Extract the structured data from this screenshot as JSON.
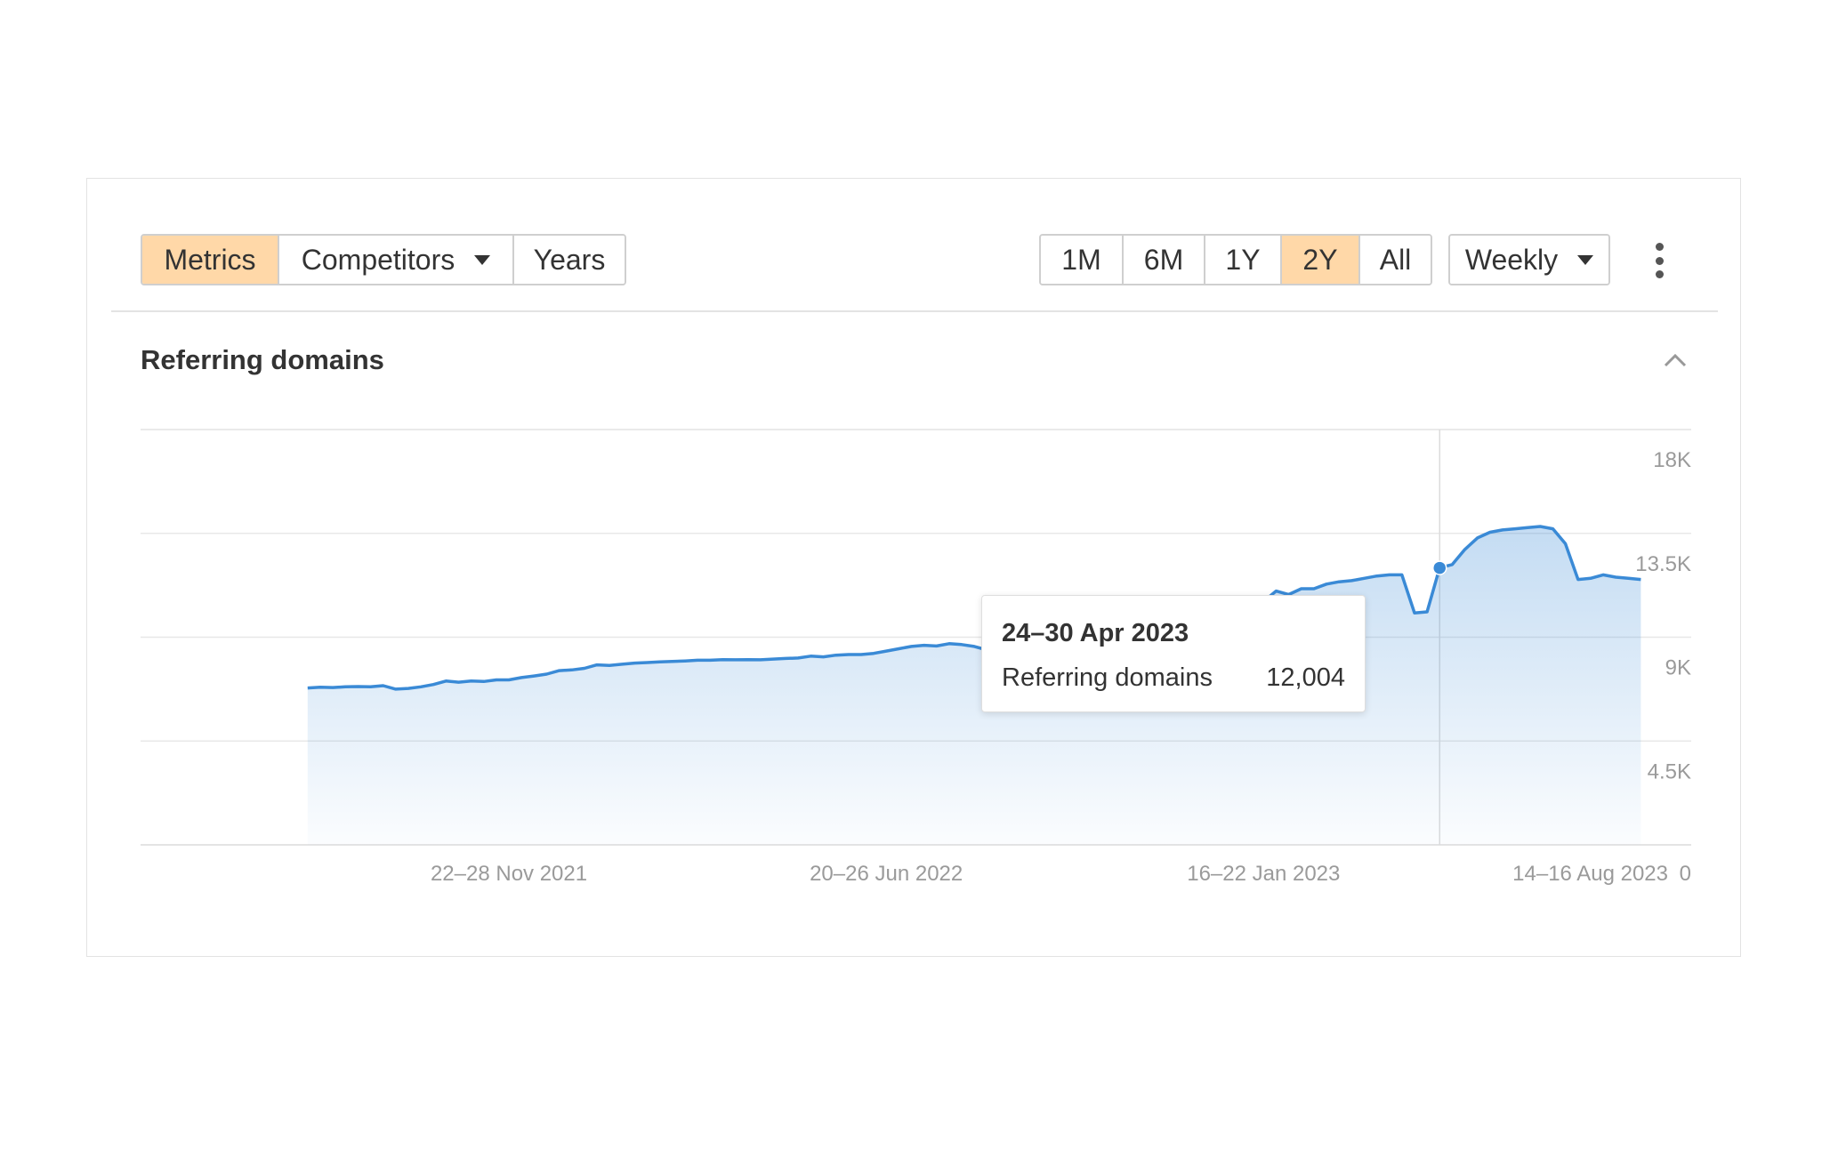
{
  "toolbar": {
    "view_tabs": [
      {
        "label": "Metrics",
        "active": true
      },
      {
        "label": "Competitors",
        "active": false,
        "dropdown": true
      },
      {
        "label": "Years",
        "active": false
      }
    ],
    "ranges": [
      {
        "label": "1M",
        "active": false
      },
      {
        "label": "6M",
        "active": false
      },
      {
        "label": "1Y",
        "active": false
      },
      {
        "label": "2Y",
        "active": true
      },
      {
        "label": "All",
        "active": false
      }
    ],
    "frequency": "Weekly",
    "menu_icon": "kebab-menu-icon",
    "active_color": "#ffd8a8"
  },
  "section": {
    "title": "Referring domains",
    "collapse_icon": "chevron-up-icon"
  },
  "tooltip": {
    "date": "24–30 Apr 2023",
    "label": "Referring domains",
    "value": "12,004"
  },
  "chart_data": {
    "type": "area",
    "series": [
      {
        "name": "Referring domains",
        "color": "#3a8ad6",
        "points": [
          [
            "2021-08-02",
            6800
          ],
          [
            "2021-08-09",
            6830
          ],
          [
            "2021-08-16",
            6820
          ],
          [
            "2021-08-23",
            6850
          ],
          [
            "2021-08-30",
            6860
          ],
          [
            "2021-09-06",
            6850
          ],
          [
            "2021-09-13",
            6900
          ],
          [
            "2021-09-20",
            6750
          ],
          [
            "2021-09-27",
            6780
          ],
          [
            "2021-10-04",
            6850
          ],
          [
            "2021-10-11",
            6950
          ],
          [
            "2021-10-18",
            7100
          ],
          [
            "2021-10-25",
            7050
          ],
          [
            "2021-11-01",
            7100
          ],
          [
            "2021-11-08",
            7080
          ],
          [
            "2021-11-15",
            7150
          ],
          [
            "2021-11-22",
            7150
          ],
          [
            "2021-11-29",
            7250
          ],
          [
            "2021-12-06",
            7320
          ],
          [
            "2021-12-13",
            7400
          ],
          [
            "2021-12-20",
            7550
          ],
          [
            "2021-12-27",
            7580
          ],
          [
            "2022-01-03",
            7650
          ],
          [
            "2022-01-10",
            7800
          ],
          [
            "2022-01-17",
            7780
          ],
          [
            "2022-01-24",
            7830
          ],
          [
            "2022-01-31",
            7880
          ],
          [
            "2022-02-07",
            7900
          ],
          [
            "2022-02-14",
            7930
          ],
          [
            "2022-02-21",
            7950
          ],
          [
            "2022-02-28",
            7970
          ],
          [
            "2022-03-07",
            8000
          ],
          [
            "2022-03-14",
            8000
          ],
          [
            "2022-03-21",
            8030
          ],
          [
            "2022-03-28",
            8020
          ],
          [
            "2022-04-04",
            8030
          ],
          [
            "2022-04-11",
            8020
          ],
          [
            "2022-04-18",
            8050
          ],
          [
            "2022-04-25",
            8080
          ],
          [
            "2022-05-02",
            8100
          ],
          [
            "2022-05-09",
            8180
          ],
          [
            "2022-05-16",
            8150
          ],
          [
            "2022-05-23",
            8220
          ],
          [
            "2022-05-30",
            8250
          ],
          [
            "2022-06-06",
            8250
          ],
          [
            "2022-06-13",
            8300
          ],
          [
            "2022-06-20",
            8400
          ],
          [
            "2022-06-27",
            8500
          ],
          [
            "2022-07-04",
            8600
          ],
          [
            "2022-07-11",
            8650
          ],
          [
            "2022-07-18",
            8620
          ],
          [
            "2022-07-25",
            8720
          ],
          [
            "2022-08-01",
            8680
          ],
          [
            "2022-08-08",
            8600
          ],
          [
            "2022-08-15",
            8450
          ],
          [
            "2022-08-22",
            8480
          ],
          [
            "2022-08-29",
            8580
          ],
          [
            "2022-09-05",
            8680
          ],
          [
            "2022-09-12",
            8750
          ],
          [
            "2022-09-19",
            8820
          ],
          [
            "2022-09-26",
            8900
          ],
          [
            "2022-10-03",
            8900
          ],
          [
            "2022-10-10",
            9000
          ],
          [
            "2022-10-17",
            9100
          ],
          [
            "2022-10-24",
            10000
          ],
          [
            "2022-10-31",
            10100
          ],
          [
            "2022-11-07",
            10250
          ],
          [
            "2022-11-14",
            10300
          ],
          [
            "2022-11-21",
            10320
          ],
          [
            "2022-11-28",
            10400
          ],
          [
            "2022-12-05",
            10400
          ],
          [
            "2022-12-12",
            10410
          ],
          [
            "2022-12-19",
            10430
          ],
          [
            "2022-12-26",
            10450
          ],
          [
            "2023-01-02",
            10500
          ],
          [
            "2023-01-09",
            10480
          ],
          [
            "2023-01-16",
            10550
          ],
          [
            "2023-01-23",
            11000
          ],
          [
            "2023-01-30",
            10850
          ],
          [
            "2023-02-06",
            11100
          ],
          [
            "2023-02-13",
            11100
          ],
          [
            "2023-02-20",
            11300
          ],
          [
            "2023-02-27",
            11400
          ],
          [
            "2023-03-06",
            11450
          ],
          [
            "2023-03-13",
            11550
          ],
          [
            "2023-03-20",
            11650
          ],
          [
            "2023-03-27",
            11700
          ],
          [
            "2023-04-03",
            11700
          ],
          [
            "2023-04-10",
            10050
          ],
          [
            "2023-04-17",
            10100
          ],
          [
            "2023-04-24",
            12004
          ],
          [
            "2023-05-01",
            12150
          ],
          [
            "2023-05-08",
            12800
          ],
          [
            "2023-05-15",
            13300
          ],
          [
            "2023-05-22",
            13550
          ],
          [
            "2023-05-29",
            13650
          ],
          [
            "2023-06-05",
            13700
          ],
          [
            "2023-06-12",
            13750
          ],
          [
            "2023-06-19",
            13800
          ],
          [
            "2023-06-26",
            13700
          ],
          [
            "2023-07-03",
            13050
          ],
          [
            "2023-07-10",
            11500
          ],
          [
            "2023-07-17",
            11550
          ],
          [
            "2023-07-24",
            11700
          ],
          [
            "2023-07-31",
            11600
          ],
          [
            "2023-08-07",
            11550
          ],
          [
            "2023-08-14",
            11500
          ]
        ]
      }
    ],
    "highlight": {
      "x": "2023-04-24",
      "y": 12004
    },
    "x_tick_labels": [
      {
        "x": "2021-11-22",
        "label": "22–28 Nov 2021"
      },
      {
        "x": "2022-06-20",
        "label": "20–26 Jun 2022"
      },
      {
        "x": "2023-01-16",
        "label": "16–22 Jan 2023"
      },
      {
        "x": "2023-08-14",
        "label": "14–16 Aug 2023"
      }
    ],
    "x_range": [
      "2021-05-01",
      "2023-09-11"
    ],
    "y_ticks": [
      {
        "value": 0,
        "label": "0"
      },
      {
        "value": 4500,
        "label": "4.5K"
      },
      {
        "value": 9000,
        "label": "9K"
      },
      {
        "value": 13500,
        "label": "13.5K"
      },
      {
        "value": 18000,
        "label": "18K"
      }
    ],
    "ylim": [
      0,
      18000
    ],
    "y_axis_side": "right",
    "grid": true,
    "fill": "gradient"
  }
}
